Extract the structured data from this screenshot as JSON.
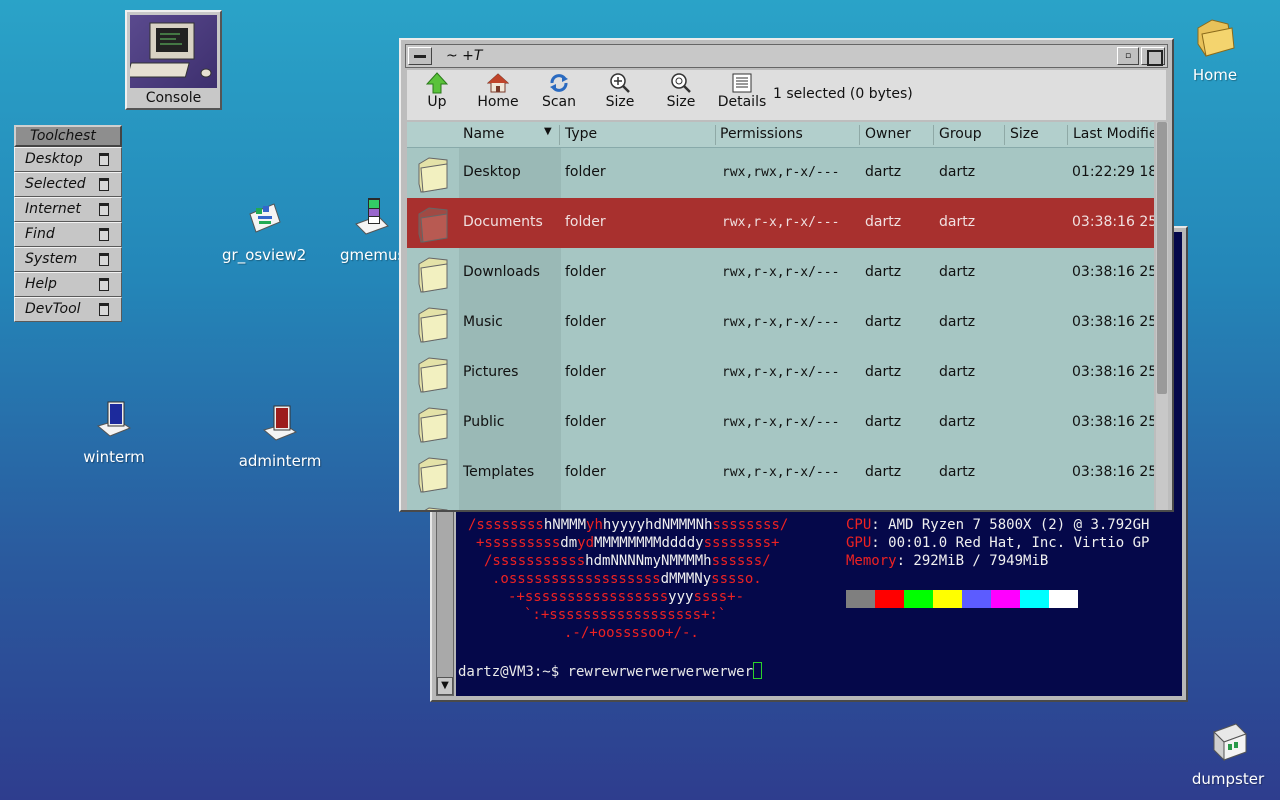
{
  "desktop": {
    "icons": {
      "console": "Console",
      "gr_osview2": "gr_osview2",
      "gmemusage": "gmemus",
      "winterm": "winterm",
      "adminterm": "adminterm",
      "home": "Home",
      "dumpster": "dumpster"
    }
  },
  "toolchest": {
    "title": "Toolchest",
    "items": [
      "Desktop",
      "Selected",
      "Internet",
      "Find",
      "System",
      "Help",
      "DevTool"
    ]
  },
  "file_manager": {
    "title": "~ +T",
    "toolbar": {
      "up": "Up",
      "home": "Home",
      "scan": "Scan",
      "size_in": "Size",
      "size_out": "Size",
      "details": "Details",
      "status": "1 selected (0 bytes)"
    },
    "columns": {
      "name": "Name",
      "type": "Type",
      "permissions": "Permissions",
      "owner": "Owner",
      "group": "Group",
      "size": "Size",
      "last_modified": "Last Modifie"
    },
    "rows": [
      {
        "name": "Desktop",
        "type": "folder",
        "perm": "rwx,rwx,r-x/---",
        "owner": "dartz",
        "group": "dartz",
        "modified": "01:22:29 18"
      },
      {
        "name": "Documents",
        "type": "folder",
        "perm": "rwx,r-x,r-x/---",
        "owner": "dartz",
        "group": "dartz",
        "modified": "03:38:16 25"
      },
      {
        "name": "Downloads",
        "type": "folder",
        "perm": "rwx,r-x,r-x/---",
        "owner": "dartz",
        "group": "dartz",
        "modified": "03:38:16 25"
      },
      {
        "name": "Music",
        "type": "folder",
        "perm": "rwx,r-x,r-x/---",
        "owner": "dartz",
        "group": "dartz",
        "modified": "03:38:16 25"
      },
      {
        "name": "Pictures",
        "type": "folder",
        "perm": "rwx,r-x,r-x/---",
        "owner": "dartz",
        "group": "dartz",
        "modified": "03:38:16 25"
      },
      {
        "name": "Public",
        "type": "folder",
        "perm": "rwx,r-x,r-x/---",
        "owner": "dartz",
        "group": "dartz",
        "modified": "03:38:16 25"
      },
      {
        "name": "Templates",
        "type": "folder",
        "perm": "rwx,r-x,r-x/---",
        "owner": "dartz",
        "group": "dartz",
        "modified": "03:38:16 25"
      }
    ]
  },
  "terminal": {
    "art": {
      "l1a": "/ssssssss",
      "l1b": "hNMMM",
      "l1c": "yh",
      "l1d": "hyyyyhdNMMMNh",
      "l1e": "ssssssss/",
      "l2a": "+sssssssss",
      "l2b": "dm",
      "l2c": "yd",
      "l2d": "MMMMMMMMddddy",
      "l2e": "ssssssss+",
      "l3a": "/sssssssssss",
      "l3b": "hdmNNNNmyNMMMMh",
      "l3c": "ssssss/",
      "l4a": ".ossssssssssssssssss",
      "l4b": "dMMMNy",
      "l4c": "sssso.",
      "l5a": "-+sssssssssssssssss",
      "l5b": "yyy",
      "l5c": "ssss+-",
      "l6": "`:+ssssssssssssssssss+:`",
      "l7": ".-/+oossssoo+/-."
    },
    "info": {
      "cpu_key": "CPU",
      "cpu_val": ": AMD Ryzen 7 5800X (2) @ 3.792GH",
      "gpu_key": "GPU",
      "gpu_val": ": 00:01.0 Red Hat, Inc. Virtio GP",
      "mem_key": "Memory",
      "mem_val": ": 292MiB / 7949MiB"
    },
    "prompt": "dartz@VM3:~$ ",
    "command": "rewrewrwerwerwerwerwer",
    "palette_top": [
      "#000000",
      "#cc0000",
      "#00cc00",
      "#cccc00",
      "#0000ee",
      "#cc00cc",
      "#00cccc",
      "#e5e5e5"
    ],
    "palette_bottom": [
      "#7f7f7f",
      "#ff0000",
      "#00ff00",
      "#ffff00",
      "#5c5cff",
      "#ff00ff",
      "#00ffff",
      "#ffffff"
    ]
  }
}
